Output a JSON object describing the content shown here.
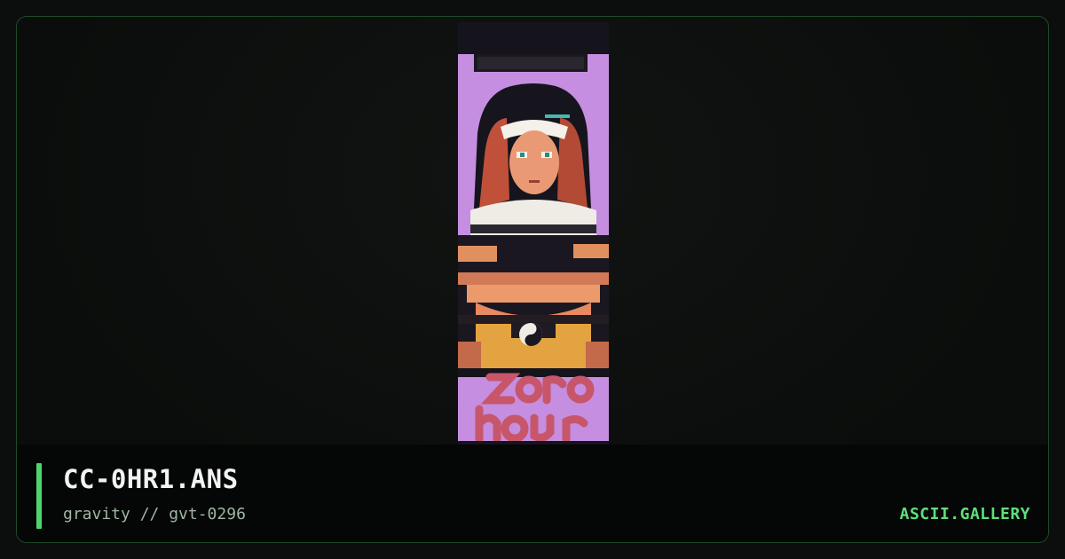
{
  "artwork": {
    "filename": "CC-0HR1.ANS",
    "byline": "gravity // gvt-0296",
    "image_icon": "ansi-art-preview-image"
  },
  "site": {
    "name": "ASCII.GALLERY"
  },
  "colors": {
    "accent": "#4ed46b",
    "brand_text": "#5ee07a",
    "border": "#1f4a27",
    "background": "#0b0e0d",
    "footer_background": "#050606"
  }
}
